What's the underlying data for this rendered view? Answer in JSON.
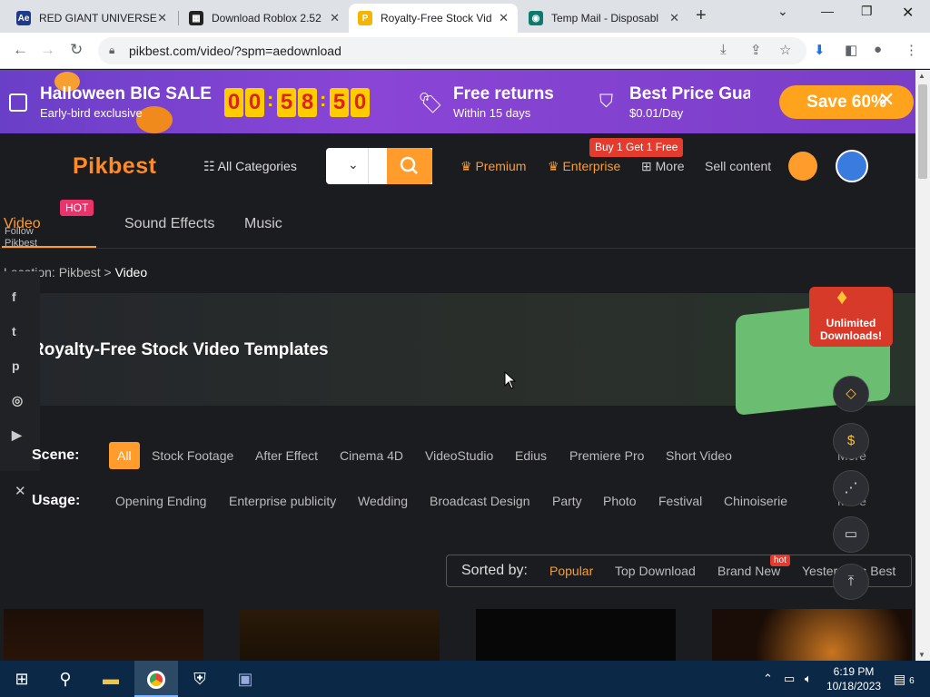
{
  "browser": {
    "tabs": [
      {
        "title": "RED GIANT UNIVERSE",
        "fav_text": "Ae",
        "fav_color": "#1c3b8a"
      },
      {
        "title": "Download Roblox 2.52",
        "fav_text": "▦",
        "fav_color": "#222222"
      },
      {
        "title": "Royalty-Free Stock Vid",
        "fav_text": "P",
        "fav_color": "#f5b400"
      },
      {
        "title": "Temp Mail - Disposabl",
        "fav_text": "◉",
        "fav_color": "#0d7a6d"
      }
    ],
    "url": "pikbest.com/video/?spm=aedownload"
  },
  "promo": {
    "title": "Halloween BIG SALE",
    "subtitle": "Early-bird exclusive",
    "countdown": [
      "0",
      "0",
      "5",
      "8",
      "5",
      "0"
    ],
    "returns_title": "Free returns",
    "returns_sub": "Within 15 days",
    "price_title": "Best Price Guarantee",
    "price_sub": "$0.01/Day",
    "save_label": "Save 60%"
  },
  "header": {
    "logo": "Pikbest",
    "categories": "All Categories",
    "premium": "Premium",
    "enterprise": "Enterprise",
    "enterprise_badge": "Buy 1 Get 1 Free",
    "more": "More",
    "sell": "Sell content"
  },
  "main_tabs": {
    "video": "Video",
    "hot": "HOT",
    "sound": "Sound Effects",
    "music": "Music",
    "follow": "Follow Pikbest"
  },
  "breadcrumb": {
    "prefix": "Location: Pikbest >",
    "current": "Video"
  },
  "hero": {
    "title": "Royalty-Free Stock Video Templates",
    "badge": "Unlimited Downloads!"
  },
  "filters": {
    "scene_label": "Scene:",
    "scene": [
      "All",
      "Stock Footage",
      "After Effect",
      "Cinema 4D",
      "VideoStudio",
      "Edius",
      "Premiere Pro",
      "Short Video"
    ],
    "usage_label": "Usage:",
    "usage": [
      "Opening Ending",
      "Enterprise publicity",
      "Wedding",
      "Broadcast Design",
      "Party",
      "Photo",
      "Festival",
      "Chinoiserie"
    ],
    "more": "More"
  },
  "sort": {
    "label": "Sorted by:",
    "options": [
      "Popular",
      "Top Download",
      "Brand New",
      "Yesterday's Best"
    ],
    "hot": "hot"
  },
  "taskbar": {
    "time": "6:19 PM",
    "date": "10/18/2023",
    "notif": "6"
  }
}
